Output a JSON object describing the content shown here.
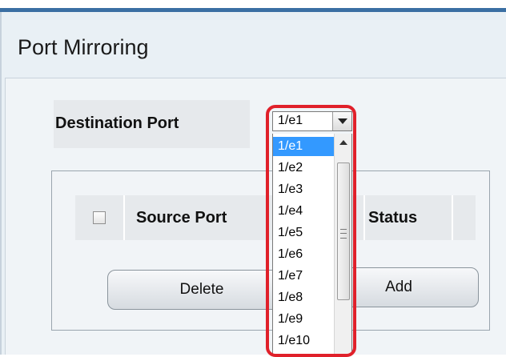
{
  "page": {
    "title": "Port Mirroring"
  },
  "destination": {
    "label": "Destination Port",
    "selected_value": "1/e1",
    "options": [
      "1/e1",
      "1/e2",
      "1/e3",
      "1/e4",
      "1/e5",
      "1/e6",
      "1/e7",
      "1/e8",
      "1/e9",
      "1/e10"
    ],
    "highlight_color": "#e0202a"
  },
  "table": {
    "columns": [
      "Source Port",
      "Status"
    ]
  },
  "buttons": {
    "delete_label": "Delete",
    "add_label": "Add"
  },
  "colors": {
    "selected_option": "#3399ff",
    "header_bar": "#3b6fa3"
  }
}
